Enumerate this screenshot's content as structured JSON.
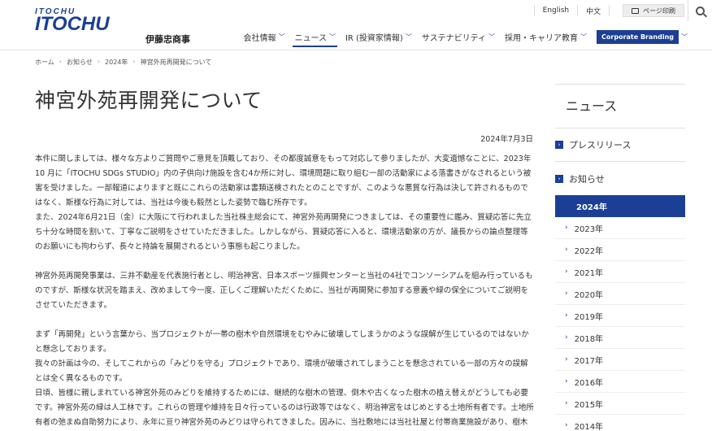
{
  "header": {
    "logo_text": "ITOCHU",
    "company_name_jp": "伊藤忠商事",
    "lang_english": "English",
    "lang_chinese": "中文",
    "print_label": "ページ印刷",
    "nav": [
      {
        "label": "会社情報"
      },
      {
        "label": "ニュース"
      },
      {
        "label": "IR (投資家情報)"
      },
      {
        "label": "サステナビリティ"
      },
      {
        "label": "採用・キャリア教育"
      }
    ],
    "corporate_branding": "Corporate Branding"
  },
  "breadcrumb": [
    "ホーム",
    "お知らせ",
    "2024年",
    "神宮外苑再開発について"
  ],
  "article": {
    "title": "神宮外苑再開発について",
    "date": "2024年7月3日",
    "paragraphs": [
      "本件に関しましては、様々な方よりご質問やご意見を頂戴しており、その都度誠意をもって対応して参りましたが、大変遺憾なことに、2023年10 月に「ITOCHU SDGs STUDIO」内の子供向け施設を含む4か所に対し、環境問題に取り組む一部の活動家による落書きがなされるという被害を受けました。一部報道によりますと既にこれらの活動家は書類送検されたとのことですが、このような悪質な行為は決して許されるものではなく、斯様な行為に対しては、当社は今後も毅然とした姿勢で臨む所存です。",
      "また、2024年6月21日（金）に大阪にて行われました当社株主総会にて、神宮外苑再開発につきましては、その重要性に鑑み、質疑応答に先立ち十分な時間を割いて、丁寧なご説明をさせていただきました。しかしながら、質疑応答に入ると、環境活動家の方が、議長からの論点整理等のお願いにも拘わらず、長々と持論を展開されるという事態も起こりました。",
      "",
      "神宮外苑再開発事業は、三井不動産を代表施行者とし、明治神宮、日本スポーツ振興センターと当社の4社でコンソーシアムを組み行っているものですが、斯様な状況を踏まえ、改めまして今一度、正しくご理解いただくために、当社が再開発に参加する意義や緑の保全についてご説明をさせていただきます。",
      "",
      "まず「再開発」という言葉から、当プロジェクトが一帯の樹木や自然環境をむやみに破壊してしまうかのような誤解が生じているのではないかと懸念しております。",
      "我々の計画は今の、そしてこれからの「みどりを守る」プロジェクトであり、環境が破壊されてしまうことを懸念されている一部の方々の誤解とは全く異なるものです。",
      "日頃、皆様に親しまれている神宮外苑のみどりを維持するためには、継続的な樹木の管理、倒木や古くなった樹木の植え替えがどうしても必要です。神宮外苑の緑は人工林です。これらの管理や維持を日々行っているのは行政等ではなく、明治神宮をはじめとする土地所有者です。土地所有者の弛まぬ自助努力により、永年に亘り神宮外苑のみどりは守られてきました。因みに、当社敷地には当社社屋と付帯商業施設があり、樹木につきましては街路樹や生垣、中庭の植栽などがあるのみです。"
    ]
  },
  "sidebar": {
    "heading": "ニュース",
    "press_release": "プレスリリース",
    "notices": "お知らせ",
    "years": [
      "2024年",
      "2023年",
      "2022年",
      "2021年",
      "2020年",
      "2019年",
      "2018年",
      "2017年",
      "2016年",
      "2015年",
      "2014年"
    ],
    "selected_year": "2024年"
  }
}
